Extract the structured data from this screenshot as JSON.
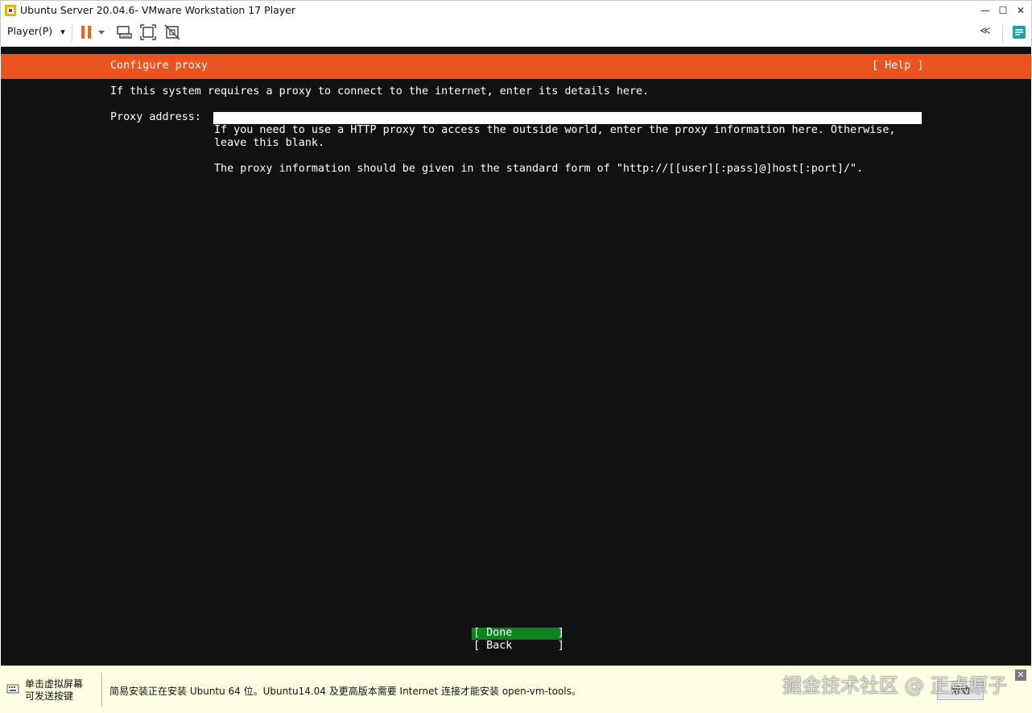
{
  "window": {
    "title": "Ubuntu Server 20.04.6- VMware Workstation 17 Player",
    "minimize_glyph": "—",
    "maximize_glyph": "☐",
    "close_glyph": "✕"
  },
  "toolbar": {
    "player_menu_label": "Player(P)",
    "dropdown_glyph": "▾",
    "collapse_glyph": "≪",
    "accent_color": "#e8651a"
  },
  "installer": {
    "header_title": "Configure proxy",
    "help_label": "[ Help ]",
    "intro": "If this system requires a proxy to connect to the internet, enter its details here.",
    "proxy_label": "Proxy address:",
    "proxy_value": "",
    "help_line1": "If you need to use a HTTP proxy to access the outside world, enter the proxy information here. Otherwise,",
    "help_line2": "leave this blank.",
    "help_line3": "The proxy information should be given in the standard form of \"http://[[user][:pass]@]host[:port]/\".",
    "done_label": "[ Done       ]",
    "back_label": "[ Back       ]",
    "header_color": "#e95420",
    "done_color": "#0e8420"
  },
  "bottombar": {
    "hint_line1": "单击虚拟屏幕",
    "hint_line2": "可发送按键",
    "message": "简易安装正在安装 Ubuntu 64 位。Ubuntu14.04 及更高版本需要 Internet 连接才能安装 open-vm-tools。",
    "help_button": "帮助",
    "watermark": "掘金技术社区 @ 正点原子",
    "close_glyph": "✕"
  }
}
